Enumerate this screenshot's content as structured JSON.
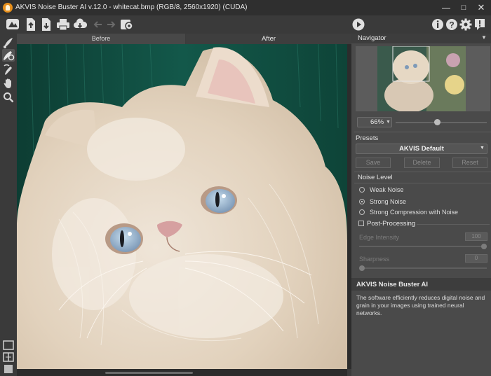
{
  "window": {
    "title": "AKVIS Noise Buster AI v.12.0 - whitecat.bmp (RGB/8, 2560x1920) (CUDA)",
    "controls": [
      "minimize-icon",
      "maximize-icon",
      "close-icon"
    ]
  },
  "toolbar": {
    "left_icons": [
      "preferences-home-icon",
      "open-file-icon",
      "save-file-icon",
      "print-icon",
      "share-icon",
      "undo-icon",
      "redo-icon",
      "batch-settings-icon"
    ],
    "run_icon": "play-icon",
    "right_icons": [
      "info-icon",
      "help-icon",
      "settings-icon",
      "notifications-icon"
    ]
  },
  "tools": {
    "items": [
      "quick-selection-brush-icon",
      "restoring-brush-icon",
      "history-brush-icon",
      "hand-icon",
      "zoom-icon"
    ],
    "view_modes": [
      "single-view-icon",
      "split-view-icon",
      "solid-view-icon"
    ]
  },
  "canvas": {
    "tab_before": "Before",
    "tab_after": "After"
  },
  "navigator": {
    "title": "Navigator",
    "zoom": "66%",
    "zoom_fraction": 0.42
  },
  "presets": {
    "label": "Presets",
    "selected": "AKVIS Default",
    "save": "Save",
    "delete": "Delete",
    "reset": "Reset"
  },
  "noise_level": {
    "label": "Noise Level",
    "options": [
      "Weak Noise",
      "Strong Noise",
      "Strong Compression with Noise"
    ],
    "selected": "Strong Noise"
  },
  "post_processing": {
    "label": "Post-Processing",
    "checked": false,
    "edge_intensity_label": "Edge Intensity",
    "edge_intensity_value": "100",
    "sharpness_label": "Sharpness",
    "sharpness_value": "0"
  },
  "info": {
    "title": "AKVIS Noise Buster AI",
    "text": "The software efficiently reduces digital noise and grain in your images using trained neural networks."
  },
  "colors": {
    "background": "#3c3c3c",
    "panel": "#4a4a4a",
    "titlebar": "#2f2f2f",
    "logo": "#e8901c"
  }
}
